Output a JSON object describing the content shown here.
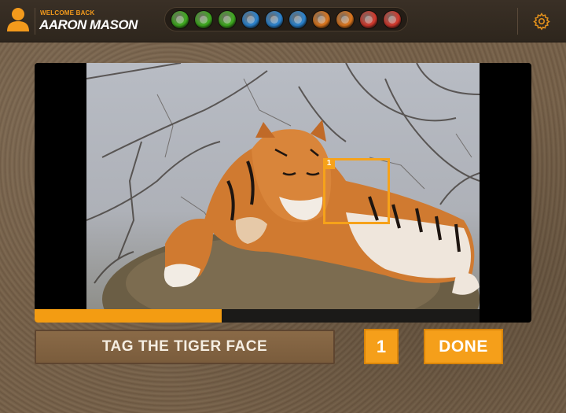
{
  "header": {
    "welcome_label": "WELCOME BACK",
    "user_name": "AARON MASON",
    "progress_gems": [
      {
        "color": "#3fae1f"
      },
      {
        "color": "#3fae1f"
      },
      {
        "color": "#3fae1f"
      },
      {
        "color": "#2b86d4"
      },
      {
        "color": "#2b86d4"
      },
      {
        "color": "#2b86d4"
      },
      {
        "color": "#e0781e"
      },
      {
        "color": "#e0781e"
      },
      {
        "color": "#d73a2e"
      },
      {
        "color": "#d73a2e"
      }
    ]
  },
  "stage": {
    "tag": {
      "number": "1"
    },
    "timer_progress": 0.42
  },
  "controls": {
    "instruction": "TAG THE TIGER FACE",
    "tag_count": "1",
    "done_label": "DONE"
  },
  "colors": {
    "accent": "#f59f1a",
    "header_bg": "#2e261d"
  }
}
